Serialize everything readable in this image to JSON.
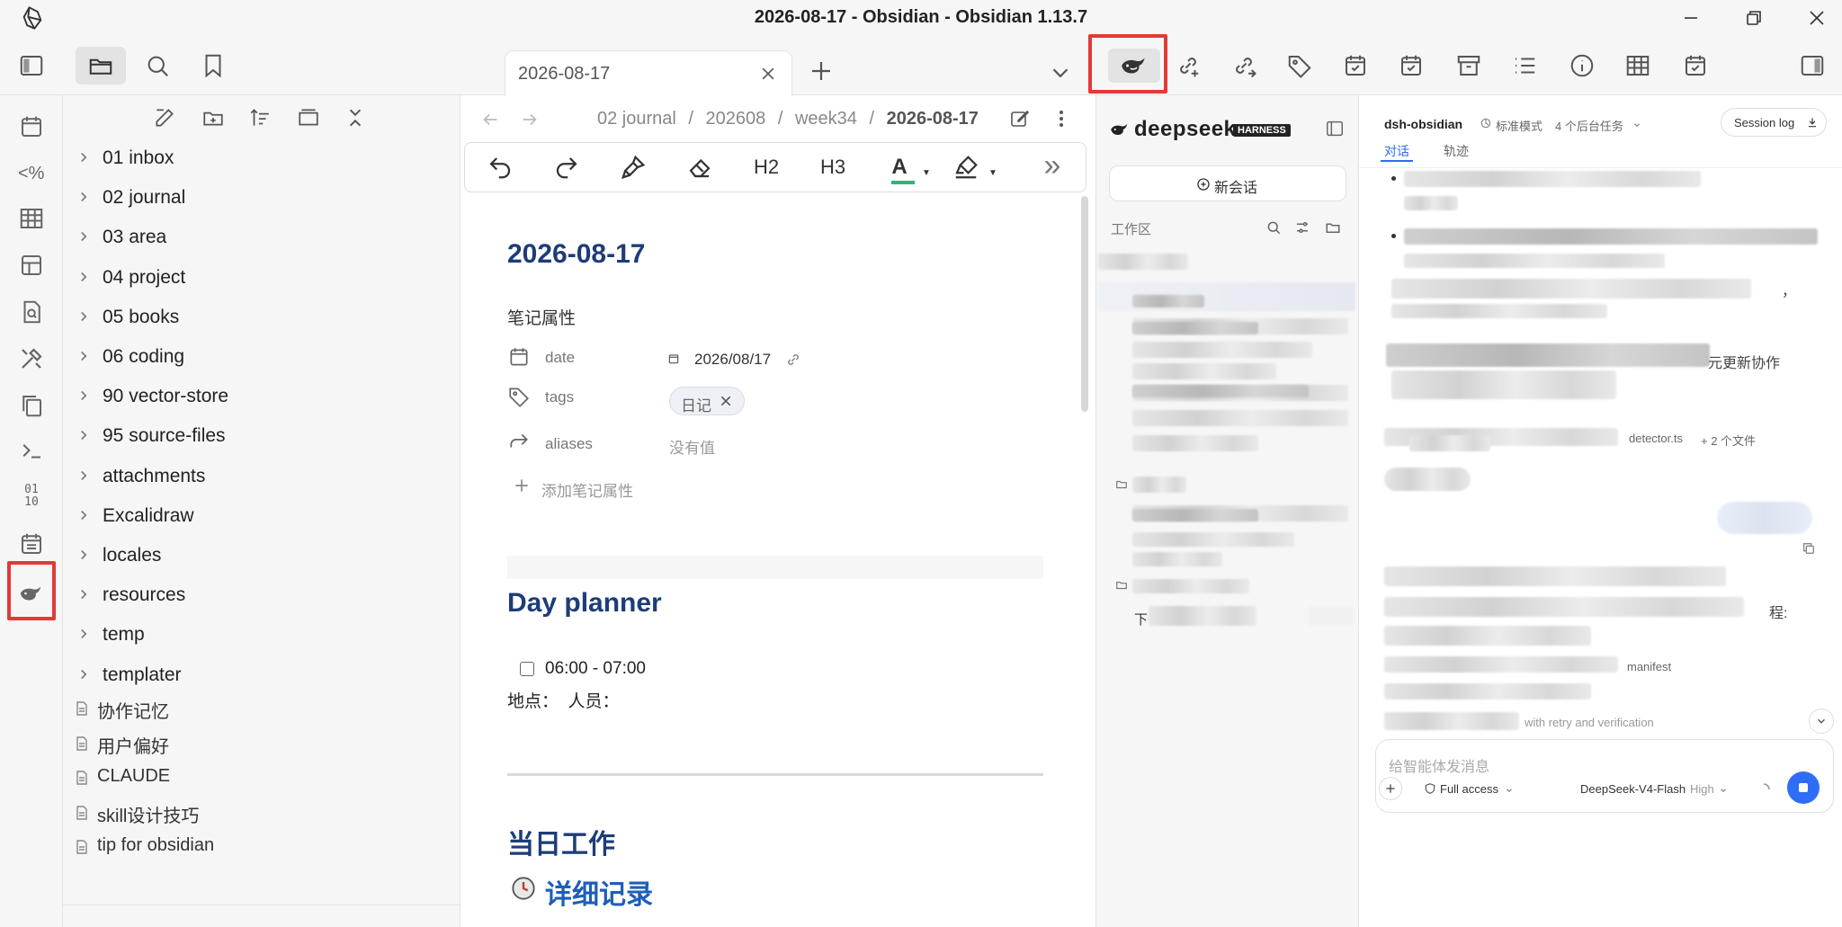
{
  "window": {
    "title": "2026-08-17 - Obsidian - Obsidian 1.13.7"
  },
  "tab": {
    "label": "2026-08-17"
  },
  "breadcrumb": {
    "parts": [
      "02 journal",
      "202608",
      "week34"
    ],
    "current": "2026-08-17",
    "sep": "/"
  },
  "explorer": {
    "folders": [
      "01 inbox",
      "02 journal",
      "03 area",
      "04 project",
      "05 books",
      "06 coding",
      "90 vector-store",
      "95 source-files",
      "attachments",
      "Excalidraw",
      "locales",
      "resources",
      "temp",
      "templater"
    ],
    "files": [
      "协作记忆",
      "用户偏好",
      "CLAUDE",
      "skill设计技巧",
      "tip for obsidian"
    ]
  },
  "format_toolbar": {
    "h2": "H2",
    "h3": "H3",
    "font_color": "A",
    "more": "»"
  },
  "note": {
    "title": "2026-08-17",
    "props_header": "笔记属性",
    "props": [
      {
        "key": "date",
        "value": "2026/08/17"
      },
      {
        "key": "tags",
        "value": "日记"
      },
      {
        "key": "aliases",
        "value": "没有值"
      }
    ],
    "add_prop": "添加笔记属性",
    "day_planner": "Day planner",
    "task_time": "06:00 - 07:00",
    "location_line": "地点：  人员：",
    "work_heading": "当日工作",
    "detail_heading": "详细记录"
  },
  "agent_sidebar": {
    "brand": "deepseek",
    "badge": "HARNESS",
    "new_chat": "新会话",
    "workspace": "工作区",
    "item_prefix": "下"
  },
  "chat": {
    "workspace_name": "dsh-obsidian",
    "mode": "标准模式",
    "bg_tasks": "4 个后台任务",
    "session_log": "Session log",
    "tabs": [
      "对话",
      "轨迹"
    ],
    "visible_fragments": {
      "collab": "元更新协作",
      "file_ref": "detector.ts",
      "more_files": "+ 2 个文件",
      "flow": "程:",
      "manifest": "manifest",
      "retry": "with retry and verification",
      "comma": "，"
    },
    "input_placeholder": "给智能体发消息",
    "access": "Full access",
    "model": "DeepSeek-V4-Flash",
    "effort": "High"
  },
  "colors": {
    "accent_blue": "#1d3c78",
    "highlight_red": "#e53935",
    "send_blue": "#2f6df6"
  }
}
